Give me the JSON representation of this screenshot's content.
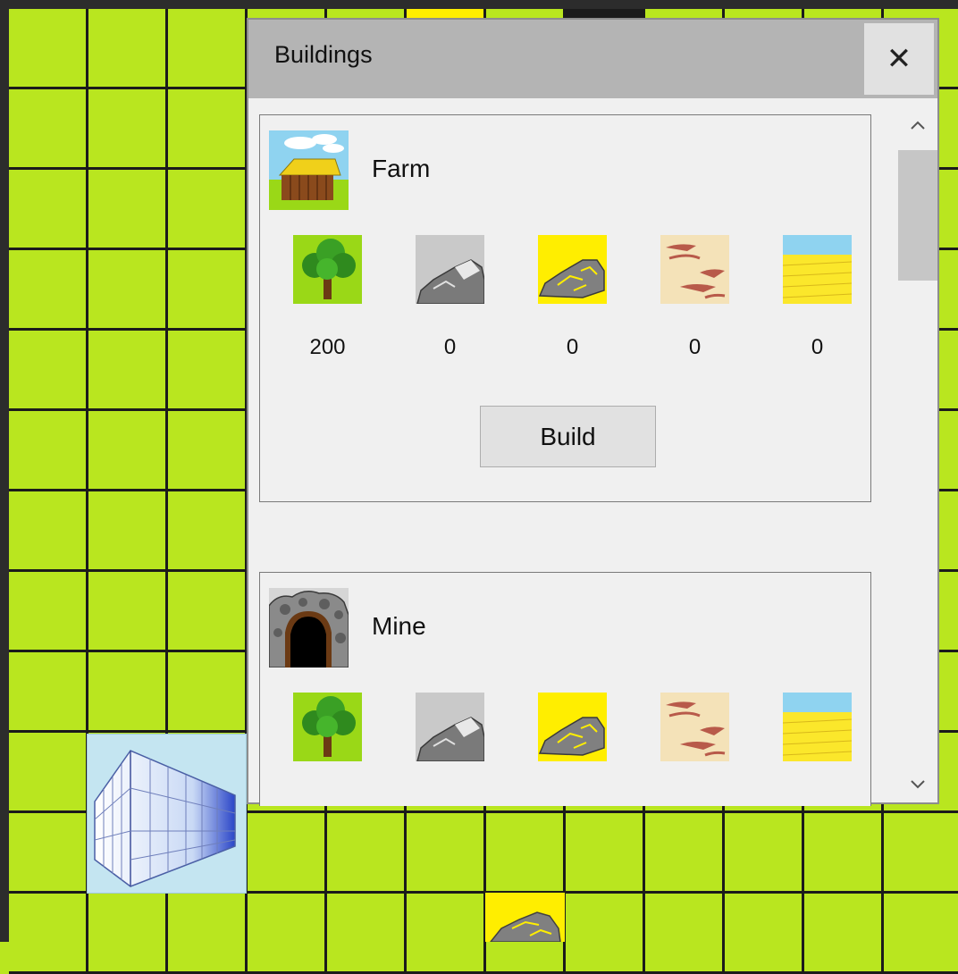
{
  "dialog": {
    "title": "Buildings",
    "close_label": "✕"
  },
  "resources": [
    "tree-icon",
    "stone-icon",
    "gold-ore-icon",
    "clay-icon",
    "wheat-field-icon"
  ],
  "buildings": [
    {
      "name": "Farm",
      "icon": "farm-icon",
      "costs": [
        "200",
        "0",
        "0",
        "0",
        "0"
      ],
      "build_label": "Build"
    },
    {
      "name": "Mine",
      "icon": "mine-icon"
    }
  ],
  "map": {
    "tile_color": "#b9e61f",
    "grid_line_color": "#1b1b1b"
  }
}
